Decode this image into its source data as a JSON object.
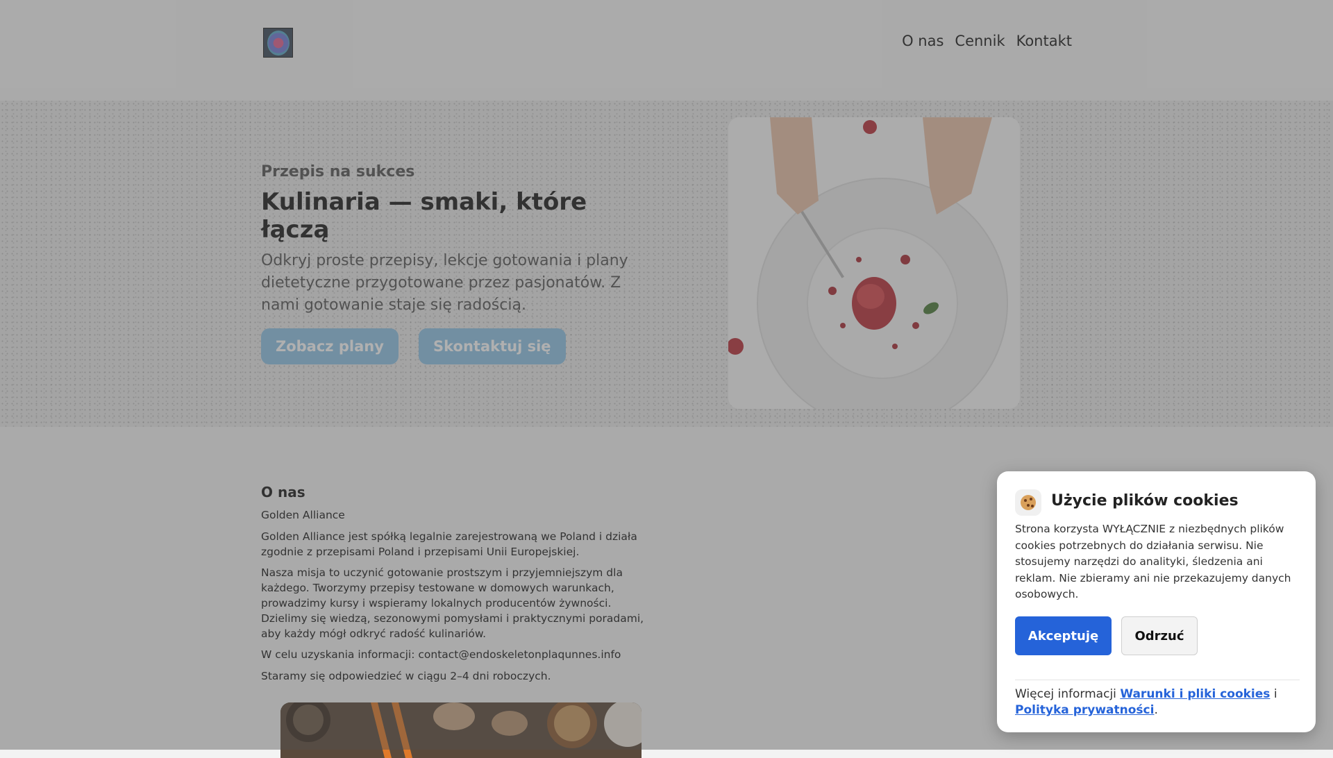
{
  "header": {
    "nav": [
      "O nas",
      "Cennik",
      "Kontakt"
    ]
  },
  "hero": {
    "kicker": "Przepis na sukces",
    "title": "Kulinaria — smaki, które łączą",
    "lead": "Odkryj proste przepisy, lekcje gotowania i plany dietetyczne przygotowane przez pasjonatów. Z nami gotowanie staje się radością.",
    "buttons": {
      "plans": "Zobacz plany",
      "contact": "Skontaktuj się"
    }
  },
  "about": {
    "heading": "O nas",
    "company": "Golden Alliance",
    "legal": "Golden Alliance jest spółką legalnie zarejestrowaną we Poland i działa zgodnie z przepisami Poland i przepisami Unii Europejskiej.",
    "mission": "Nasza misja to uczynić gotowanie prostszym i przyjemniejszym dla każdego. Tworzymy przepisy testowane w domowych warunkach, prowadzimy kursy i wspieramy lokalnych producentów żywności. Dzielimy się wiedzą, sezonowymi pomysłami i praktycznymi poradami, aby każdy mógł odkryć radość kulinariów.",
    "contact": "W celu uzyskania informacji: contact@endoskeletonplaqunnes.info",
    "response": "Staramy się odpowiedzieć w ciągu 2–4 dni roboczych."
  },
  "cookie": {
    "title": "Użycie plików cookies",
    "text": "Strona korzysta WYŁĄCZNIE z niezbędnych plików cookies potrzebnych do działania serwisu. Nie stosujemy narzędzi do analityki, śledzenia ani reklam. Nie zbieramy ani nie przekazujemy danych osobowych.",
    "accept": "Akceptuję",
    "reject": "Odrzuć",
    "more_prefix": "Więcej informacji",
    "link_terms": "Warunki i pliki cookies",
    "conjunction": "i",
    "link_privacy": "Polityka prywatności",
    "suffix": "."
  },
  "colors": {
    "accent": "#2563d9",
    "hero_button": "#8fc3e6"
  }
}
